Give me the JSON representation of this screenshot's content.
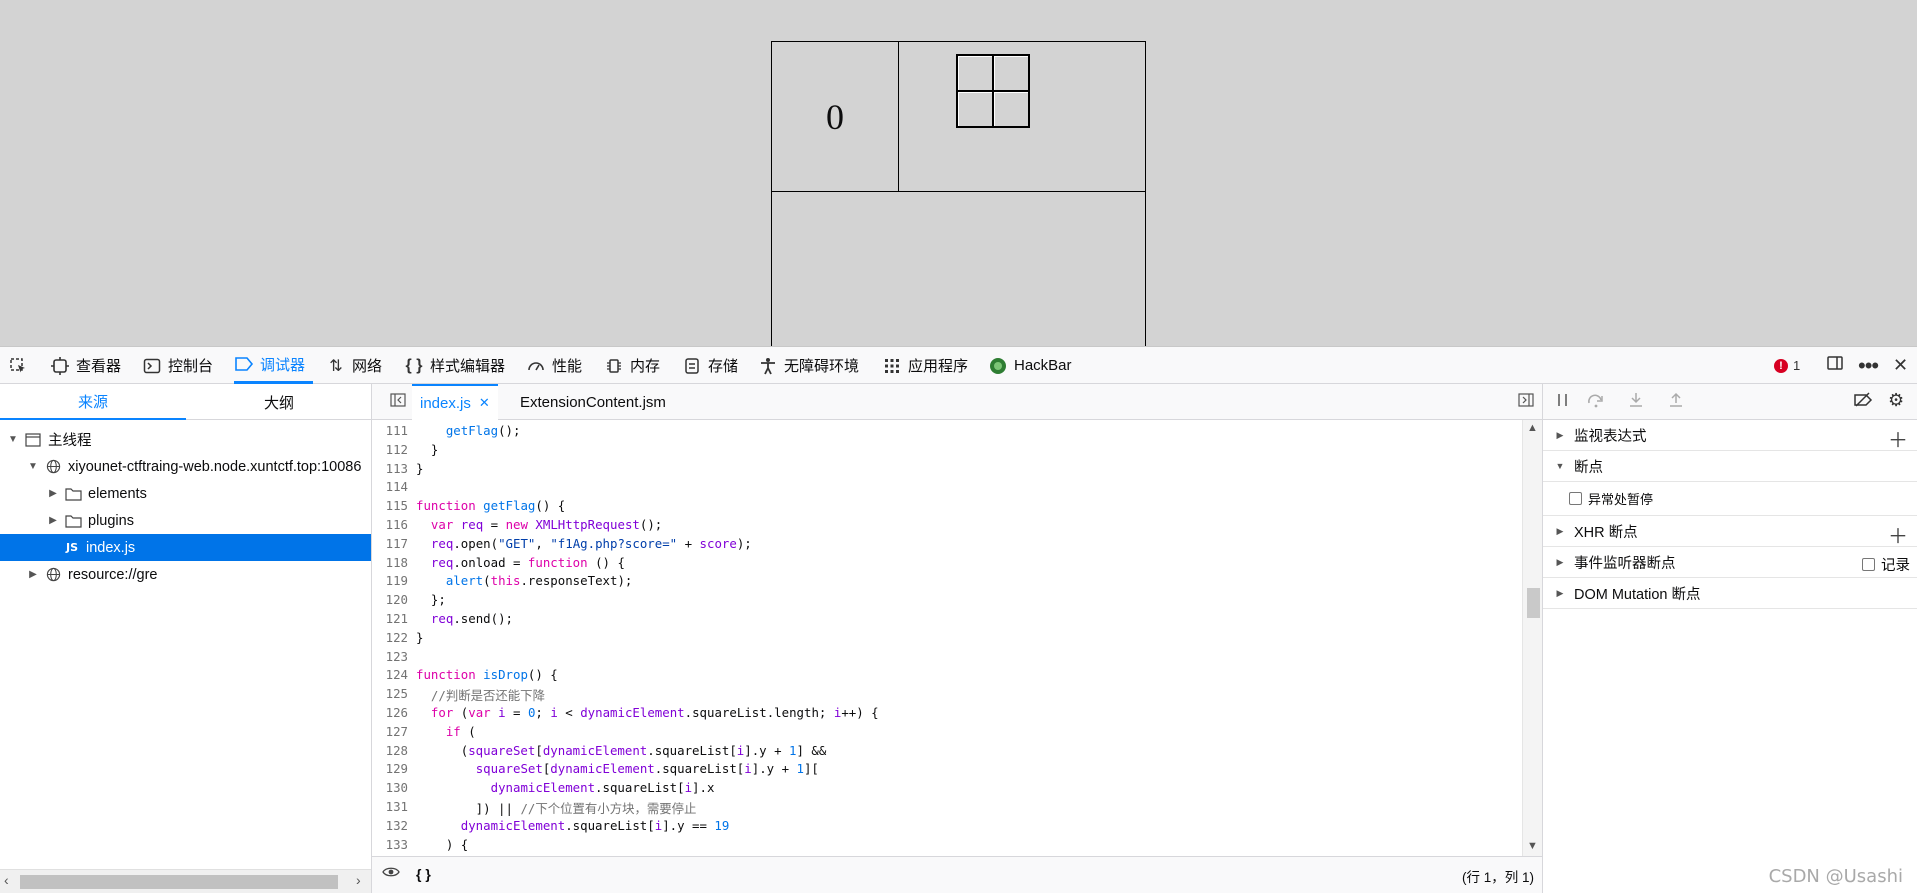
{
  "game": {
    "score": "0"
  },
  "toolbar": {
    "items": [
      {
        "label": "查看器",
        "icon": "inspector-icon"
      },
      {
        "label": "控制台",
        "icon": "console-icon"
      },
      {
        "label": "调试器",
        "icon": "debugger-icon"
      },
      {
        "label": "网络",
        "icon": "network-icon"
      },
      {
        "label": "样式编辑器",
        "icon": "style-editor-icon"
      },
      {
        "label": "性能",
        "icon": "performance-icon"
      },
      {
        "label": "内存",
        "icon": "memory-icon"
      },
      {
        "label": "存储",
        "icon": "storage-icon"
      },
      {
        "label": "无障碍环境",
        "icon": "accessibility-icon"
      },
      {
        "label": "应用程序",
        "icon": "application-icon"
      },
      {
        "label": "HackBar",
        "icon": "hackbar-icon"
      }
    ],
    "error_count": "1",
    "selected": "调试器"
  },
  "sources": {
    "tabs": [
      "来源",
      "大纲"
    ],
    "tree": {
      "main_thread": "主线程",
      "host": "xiyounet-ctftraing-web.node.xuntctf.top:10086",
      "folder_elements": "elements",
      "folder_plugins": "plugins",
      "file_index": "index.js",
      "file_badge": "JS",
      "resource": "resource://gre"
    }
  },
  "editor": {
    "tabs": [
      "index.js",
      "ExtensionContent.jsm"
    ],
    "active_tab": "index.js",
    "close_glyph": "✕",
    "code_lines": [
      {
        "n": "111",
        "html": "    <span class='fn'>getFlag</span>();"
      },
      {
        "n": "112",
        "html": "  }"
      },
      {
        "n": "113",
        "html": "}"
      },
      {
        "n": "114",
        "html": ""
      },
      {
        "n": "115",
        "html": "<span class='kw'>function</span> <span class='fn'>getFlag</span>() {"
      },
      {
        "n": "116",
        "html": "  <span class='kw'>var</span> <span class='vr'>req</span> = <span class='kw'>new</span> <span class='vr'>XMLHttpRequest</span>();"
      },
      {
        "n": "117",
        "html": "  <span class='vr'>req</span>.open(<span class='str'>\"GET\"</span>, <span class='str'>\"f1Ag.php?score=\"</span> + <span class='vr'>score</span>);"
      },
      {
        "n": "118",
        "html": "  <span class='vr'>req</span>.onload = <span class='kw'>function</span> () {"
      },
      {
        "n": "119",
        "html": "    <span class='fn'>alert</span>(<span class='kw'>this</span>.responseText);"
      },
      {
        "n": "120",
        "html": "  };"
      },
      {
        "n": "121",
        "html": "  <span class='vr'>req</span>.send();"
      },
      {
        "n": "122",
        "html": "}"
      },
      {
        "n": "123",
        "html": ""
      },
      {
        "n": "124",
        "html": "<span class='kw'>function</span> <span class='fn'>isDrop</span>() {"
      },
      {
        "n": "125",
        "html": "  <span class='cmt'>//判断是否还能下降</span>"
      },
      {
        "n": "126",
        "html": "  <span class='kw'>for</span> (<span class='kw'>var</span> <span class='vr'>i</span> = <span class='num'>0</span>; <span class='vr'>i</span> &lt; <span class='vr'>dynamicElement</span>.squareList.length; <span class='vr'>i</span>++) {"
      },
      {
        "n": "127",
        "html": "    <span class='kw'>if</span> ("
      },
      {
        "n": "128",
        "html": "      (<span class='vr'>squareSet</span>[<span class='vr'>dynamicElement</span>.squareList[<span class='vr'>i</span>].y + <span class='num'>1</span>] &amp;&amp;"
      },
      {
        "n": "129",
        "html": "        <span class='vr'>squareSet</span>[<span class='vr'>dynamicElement</span>.squareList[<span class='vr'>i</span>].y + <span class='num'>1</span>]["
      },
      {
        "n": "130",
        "html": "          <span class='vr'>dynamicElement</span>.squareList[<span class='vr'>i</span>].x"
      },
      {
        "n": "131",
        "html": "        ]) || <span class='cmt'>//下个位置有小方块，需要停止</span>"
      },
      {
        "n": "132",
        "html": "      <span class='vr'>dynamicElement</span>.squareList[<span class='vr'>i</span>].y == <span class='num'>19</span>"
      },
      {
        "n": "133",
        "html": "    ) {"
      }
    ],
    "footer_braces": "{ }",
    "cursor_position": "(行 1，列 1)"
  },
  "debugger_panel": {
    "watch": "监视表达式",
    "breakpoints": "断点",
    "pause_on_exceptions": "异常处暂停",
    "xhr_breakpoints": "XHR 断点",
    "event_breakpoints": "事件监听器断点",
    "log_label": "记录",
    "dom_mutation": "DOM Mutation 断点"
  },
  "watermark": "CSDN @Usashi",
  "colors": {
    "accent": "#0a84ff",
    "selection": "#0074e8",
    "game_bg": "#d3d3d3",
    "error": "#d70022"
  }
}
